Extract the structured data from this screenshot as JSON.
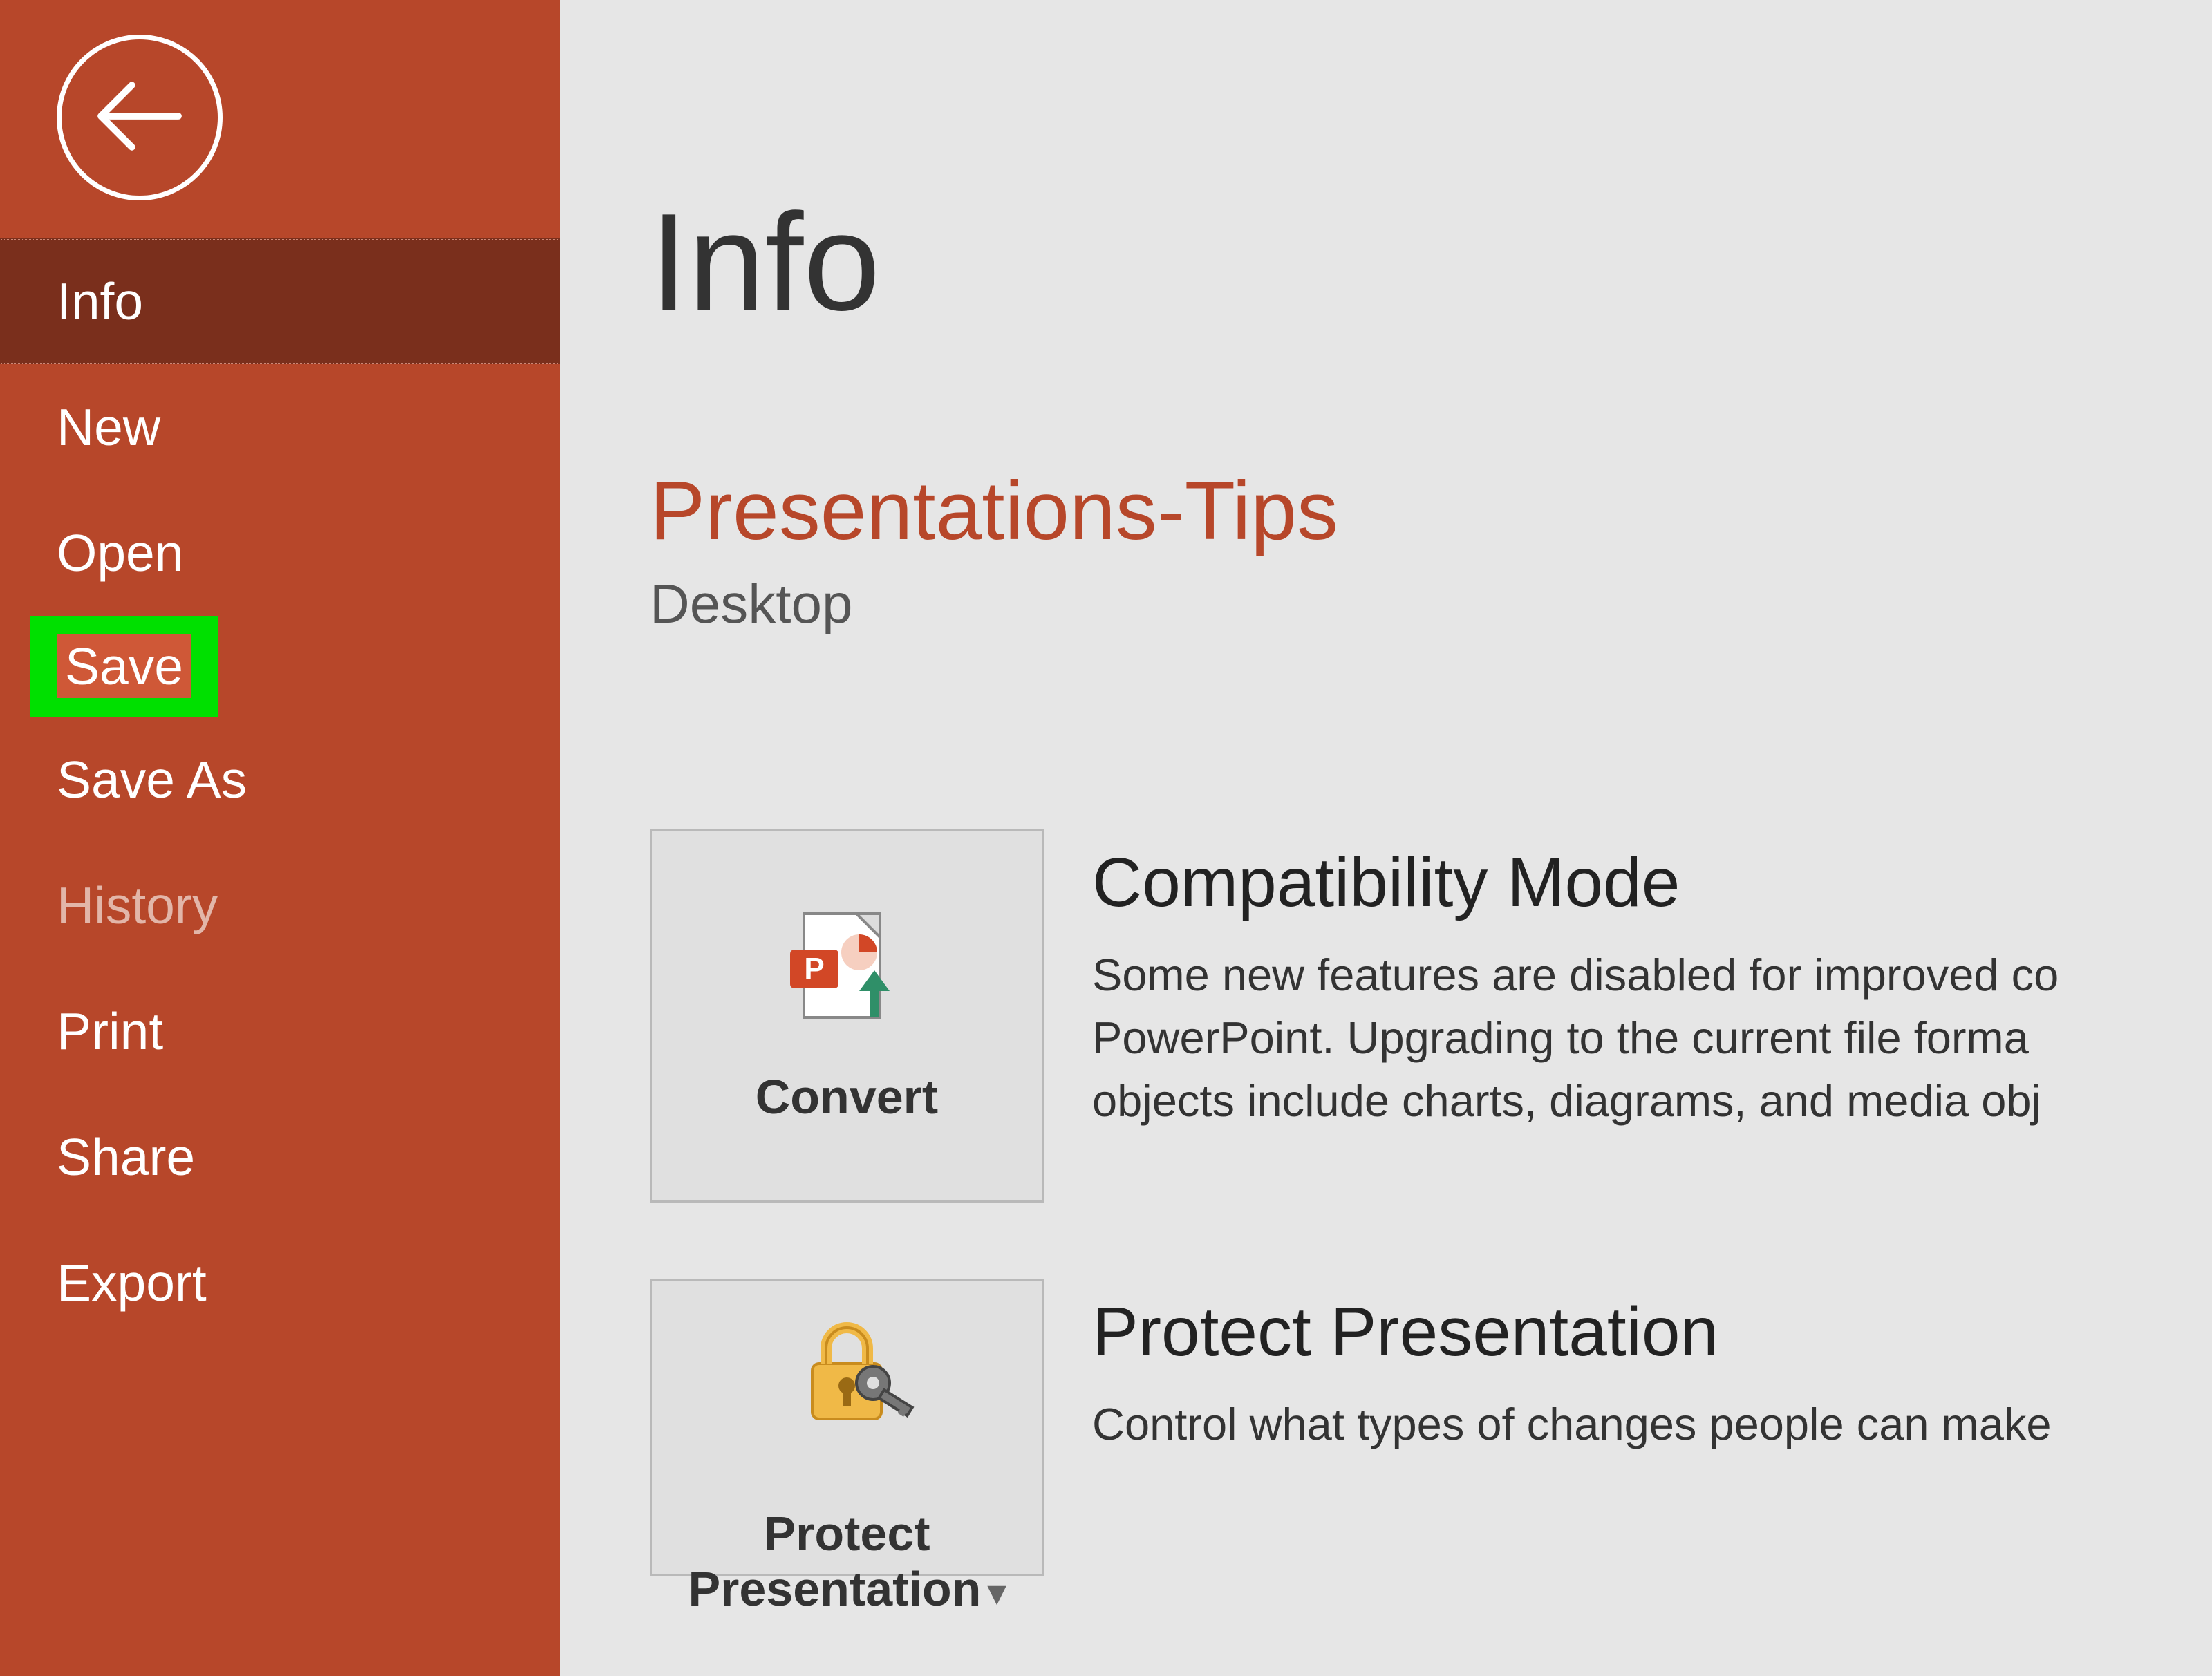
{
  "colors": {
    "sidebar_bg": "#b7472a",
    "sidebar_selected_bg": "#7a2f1c",
    "highlight_green": "#00e000",
    "highlight_orange": "#cf5837",
    "main_bg": "#e6e6e6",
    "accent": "#b7472a"
  },
  "sidebar": {
    "items": [
      {
        "label": "Info",
        "state": "selected"
      },
      {
        "label": "New",
        "state": "normal"
      },
      {
        "label": "Open",
        "state": "normal"
      },
      {
        "label": "Save",
        "state": "highlighted"
      },
      {
        "label": "Save As",
        "state": "normal"
      },
      {
        "label": "History",
        "state": "disabled"
      },
      {
        "label": "Print",
        "state": "normal"
      },
      {
        "label": "Share",
        "state": "normal"
      },
      {
        "label": "Export",
        "state": "normal"
      }
    ]
  },
  "main": {
    "page_title": "Info",
    "document_title": "Presentations-Tips",
    "document_location": "Desktop",
    "sections": [
      {
        "tile_label": "Convert",
        "heading": "Compatibility Mode",
        "desc_line1": "Some new features are disabled for improved co",
        "desc_line2": "PowerPoint. Upgrading to the current file forma",
        "desc_line3": "objects include charts, diagrams, and media obj",
        "has_dropdown": false
      },
      {
        "tile_label": "Protect\nPresentation",
        "heading": "Protect Presentation",
        "desc_line1": "Control what types of changes people can make",
        "desc_line2": "",
        "desc_line3": "",
        "has_dropdown": true
      }
    ]
  }
}
